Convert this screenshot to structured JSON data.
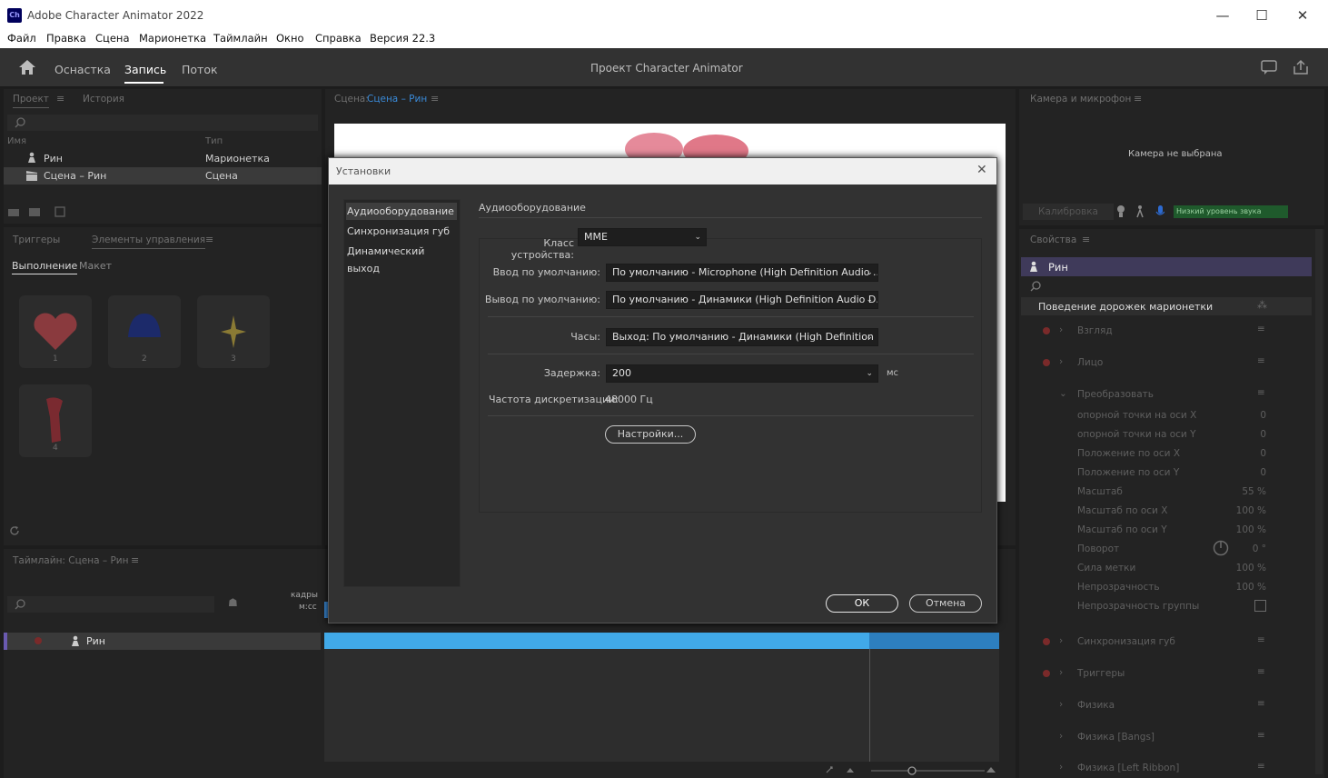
{
  "window": {
    "logo": "Ch",
    "title": "Adobe Character Animator 2022",
    "minimize": "—",
    "maximize": "☐",
    "close": "✕"
  },
  "menu": [
    "Файл",
    "Правка",
    "Сцена",
    "Марионетка",
    "Таймлайн",
    "Окно",
    "Справка",
    "Версия 22.3"
  ],
  "workspace": {
    "tabs": [
      "Оснастка",
      "Запись",
      "Поток"
    ],
    "active_tab": "Запись",
    "project_title": "Проект Character Animator"
  },
  "project_panel": {
    "tabs": [
      "Проект",
      "История"
    ],
    "col_name": "Имя",
    "col_type": "Тип",
    "rows": [
      {
        "name": "Рин",
        "type": "Марионетка"
      },
      {
        "name": "Сцена – Рин",
        "type": "Сцена"
      }
    ]
  },
  "controls_panel": {
    "tabs": [
      "Триггеры",
      "Элементы управления"
    ],
    "subtabs": [
      "Выполнение",
      "Макет"
    ],
    "triggers": [
      "1",
      "2",
      "3",
      "4"
    ]
  },
  "scene_panel": {
    "label": "Сцена:",
    "scene_name": "Сцена – Рин"
  },
  "camera_panel": {
    "title": "Камера и микрофон",
    "no_camera": "Камера не выбрана",
    "calibration": "Калибровка",
    "audio_level": "Низкий уровень звука"
  },
  "properties_panel": {
    "title": "Свойства",
    "puppet": "Рин",
    "section": "Поведение дорожек марионетки",
    "behaviors": [
      "Взгляд",
      "Лицо",
      "Преобразовать"
    ],
    "transform_props": [
      {
        "label": "опорной точки на оси X",
        "value": "0"
      },
      {
        "label": "опорной точки на оси Y",
        "value": "0"
      },
      {
        "label": "Положение по оси X",
        "value": "0"
      },
      {
        "label": "Положение по оси Y",
        "value": "0"
      },
      {
        "label": "Масштаб",
        "value": "55 %"
      },
      {
        "label": "Масштаб по оси X",
        "value": "100 %"
      },
      {
        "label": "Масштаб по оси Y",
        "value": "100 %"
      },
      {
        "label": "Поворот",
        "value": "0 °"
      },
      {
        "label": "Сила метки",
        "value": "100 %"
      },
      {
        "label": "Непрозрачность",
        "value": "100 %"
      },
      {
        "label": "Непрозрачность группы",
        "value": ""
      }
    ],
    "more_behaviors": [
      "Синхронизация губ",
      "Триггеры",
      "Физика",
      "Физика [Bangs]",
      "Физика [Left Ribbon]"
    ]
  },
  "timeline": {
    "title": "Таймлайн: Сцена – Рин",
    "frames": "кадры",
    "mss": "м:сс",
    "track": "Рин"
  },
  "dialog": {
    "title": "Установки",
    "categories": [
      "Аудиооборудование",
      "Синхронизация губ",
      "Динамический выход"
    ],
    "selected": "Аудиооборудование",
    "section_title": "Аудиооборудование",
    "device_class_label": "Класс устройства:",
    "device_class_value": "MME",
    "input_label": "Ввод по умолчанию:",
    "input_value": "По умолчанию - Microphone (High Definition Audio ...",
    "output_label": "Вывод по умолчанию:",
    "output_value": "По умолчанию - Динамики (High Definition Audio D...",
    "clock_label": "Часы:",
    "clock_value": "Выход: По умолчанию - Динамики (High Definition ...",
    "latency_label": "Задержка:",
    "latency_value": "200",
    "latency_unit": "мс",
    "sample_rate_label": "Частота дискретизации:",
    "sample_rate_value": "48000 Гц",
    "settings_button": "Настройки...",
    "ok_button": "ОК",
    "cancel_button": "Отмена"
  }
}
